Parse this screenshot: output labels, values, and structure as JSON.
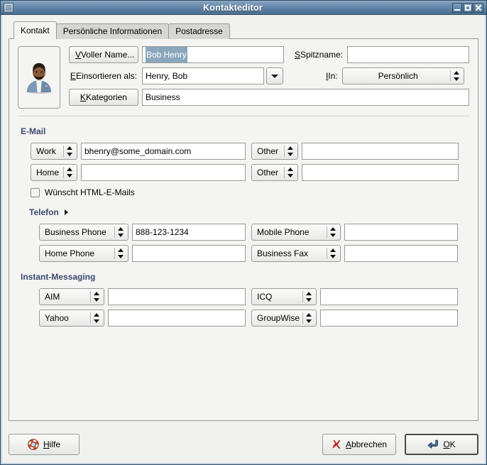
{
  "window": {
    "title": "Kontakteditor",
    "icon": "contact-editor-icon",
    "buttons": {
      "minimize": "minimize-icon",
      "maximize": "maximize-icon",
      "close": "close-icon"
    }
  },
  "tabs": [
    {
      "label": "Kontakt",
      "active": true
    },
    {
      "label": "Persönliche Informationen",
      "active": false
    },
    {
      "label": "Postadresse",
      "active": false
    }
  ],
  "contact": {
    "avatar_icon": "contact-photo-icon",
    "full_name_button": "Voller Name...",
    "full_name_value": "Bob Henry",
    "full_name_selected": true,
    "nickname_label": "Spitzname:",
    "nickname_value": "",
    "file_as_label": "Einsortieren als:",
    "file_as_value": "Henry, Bob",
    "in_label": "In:",
    "in_value": "Persönlich",
    "categories_button": "Kategorien",
    "categories_value": "Business"
  },
  "email": {
    "title": "E-Mail",
    "rows": [
      {
        "type_left": "Work",
        "value_left": "bhenry@some_domain.com",
        "type_right": "Other",
        "value_right": ""
      },
      {
        "type_left": "Home",
        "value_left": "",
        "type_right": "Other",
        "value_right": ""
      }
    ],
    "html_checkbox_label": "Wünscht HTML-E-Mails",
    "html_checkbox_checked": false
  },
  "phone": {
    "title": "Telefon",
    "expander": "expander-arrow-icon",
    "rows": [
      {
        "type_left": "Business Phone",
        "value_left": "888-123-1234",
        "type_right": "Mobile Phone",
        "value_right": ""
      },
      {
        "type_left": "Home Phone",
        "value_left": "",
        "type_right": "Business Fax",
        "value_right": ""
      }
    ]
  },
  "im": {
    "title": "Instant-Messaging",
    "rows": [
      {
        "type_left": "AIM",
        "value_left": "",
        "type_right": "ICQ",
        "value_right": ""
      },
      {
        "type_left": "Yahoo",
        "value_left": "",
        "type_right": "GroupWise",
        "value_right": ""
      }
    ]
  },
  "actions": {
    "help_label": "Hilfe",
    "help_icon": "lifebuoy-help-icon",
    "cancel_label": "Abbrechen",
    "cancel_icon": "x-cross-icon",
    "ok_label": "OK",
    "ok_icon": "enter-arrow-icon"
  },
  "colors": {
    "titlebar": "#5d82a5",
    "section_heading": "#3c4a6b",
    "selection": "#8aa7bd",
    "panel": "#f4f4f3",
    "window_bg": "#f1f1f0"
  }
}
